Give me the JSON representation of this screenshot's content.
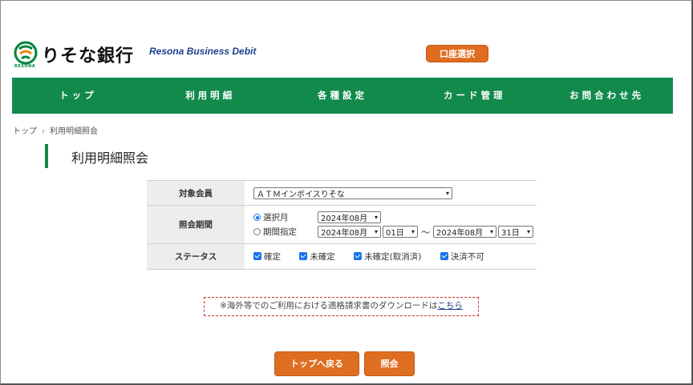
{
  "header": {
    "bank_name": "りそな銀行",
    "logo_sub": "RESONA",
    "brand_tag": "Resona Business Debit",
    "account_select_button": "口座選択",
    "brand_color": "#118a4c",
    "accent_color": "#de6e21"
  },
  "nav": {
    "items": [
      "トップ",
      "利用明細",
      "各種設定",
      "カード管理",
      "お問合わせ先"
    ]
  },
  "breadcrumb": {
    "home": "トップ",
    "separator": "›",
    "current": "利用明細照会"
  },
  "page": {
    "title": "利用明細照会"
  },
  "form": {
    "member": {
      "label": "対象会員",
      "value": "ＡＴＭインボイスりそな"
    },
    "period": {
      "label": "照会期間",
      "option_month": "選択月",
      "option_month_value": "2024年08月",
      "option_range": "期間指定",
      "range_start_month": "2024年08月",
      "range_start_day": "01日",
      "tilde": "～",
      "range_end_month": "2024年08月",
      "range_end_day": "31日",
      "selected": "選択月"
    },
    "status": {
      "label": "ステータス",
      "options": [
        "確定",
        "未確定",
        "未確定(取消済)",
        "決済不可"
      ]
    }
  },
  "notice": {
    "text": "※海外等でのご利用における適格請求書のダウンロードは",
    "link": "こちら"
  },
  "buttons": {
    "back": "トップへ戻る",
    "search": "照会"
  }
}
